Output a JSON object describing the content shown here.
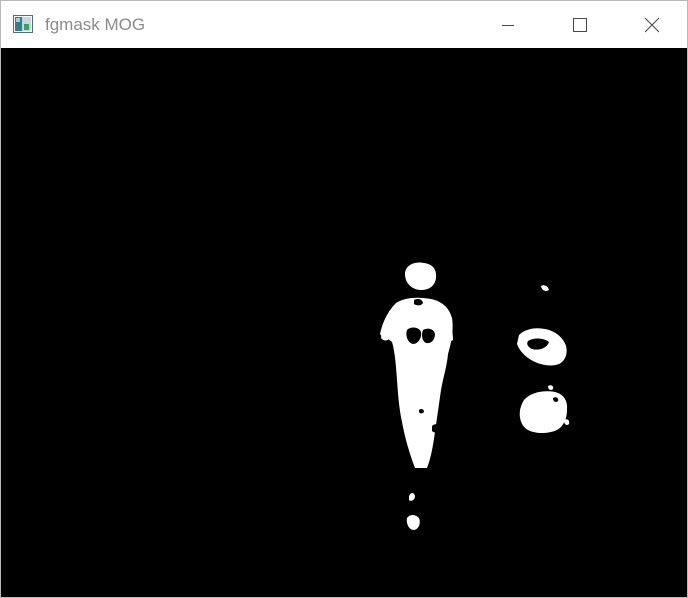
{
  "window": {
    "title": "fgmask MOG",
    "icon": "image-window-icon",
    "controls": {
      "minimize_icon": "minimize-icon",
      "maximize_icon": "maximize-icon",
      "close_icon": "close-icon"
    }
  },
  "image": {
    "description_kind": "binary foreground mask",
    "background_color": "#000000",
    "foreground_color": "#ffffff"
  }
}
